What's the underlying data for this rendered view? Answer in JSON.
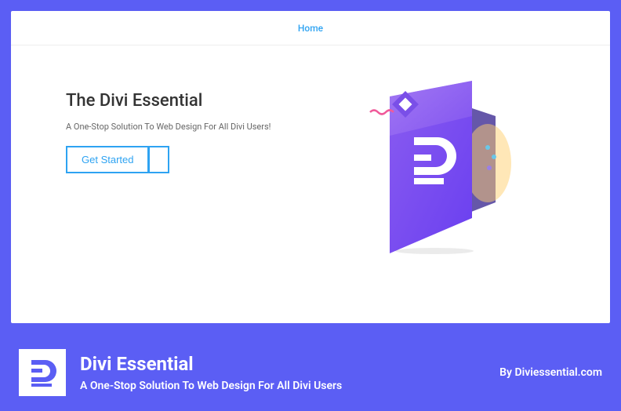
{
  "nav": {
    "home": "Home"
  },
  "hero": {
    "title": "The Divi Essential",
    "subtitle": "A One-Stop Solution To Web Design For All Divi Users!",
    "button_label": "Get Started"
  },
  "footer": {
    "title": "Divi Essential",
    "subtitle": "A One-Stop Solution To Web Design For All Divi Users",
    "byline": "By Diviessential.com"
  }
}
